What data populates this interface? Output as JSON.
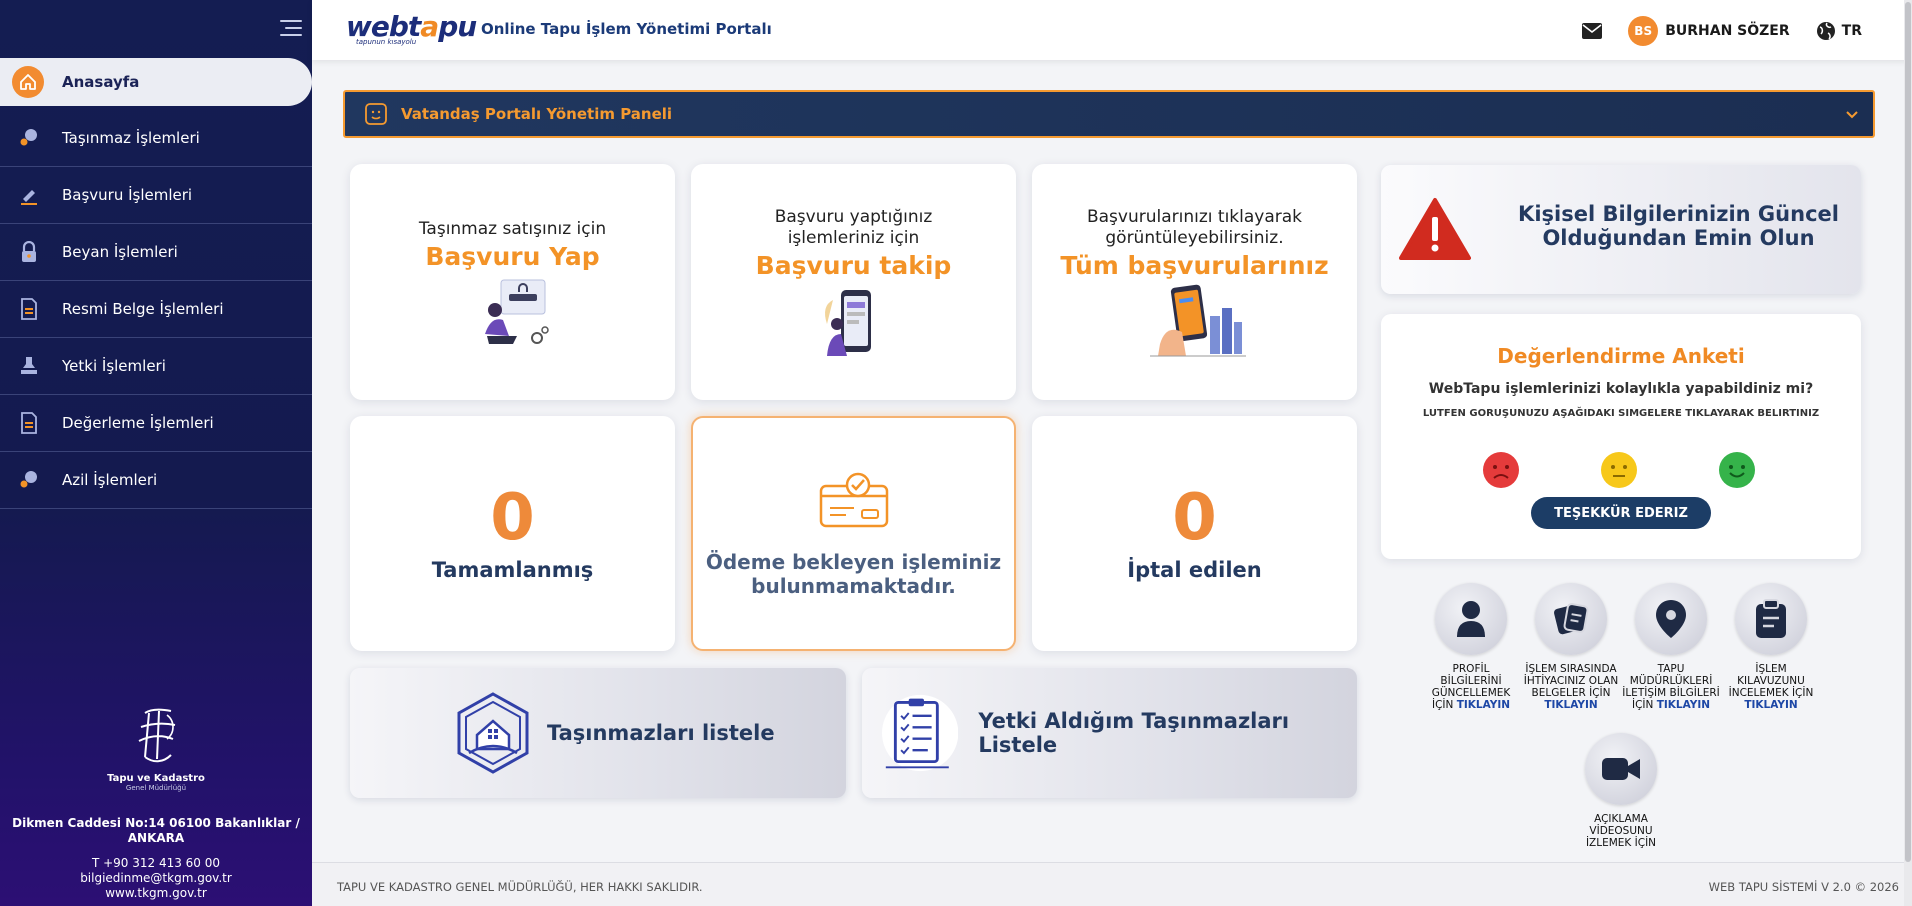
{
  "header": {
    "brand_prefix": "web",
    "brand_mid": "t",
    "brand_o": "a",
    "brand_suffix": "pu",
    "brand_tagline": "tapunun kısayolu",
    "portal_title": "Online Tapu İşlem Yönetimi Portalı",
    "user_initials": "BS",
    "user_name": "BURHAN SÖZER",
    "language": "TR",
    "icons": [
      "menu-icon",
      "mail-icon",
      "globe-icon"
    ]
  },
  "sidebar": {
    "items": [
      {
        "label": "Anasayfa",
        "icon": "home-icon",
        "active": true
      },
      {
        "label": "Taşınmaz İşlemleri",
        "icon": "map-pin-icon"
      },
      {
        "label": "Başvuru İşlemleri",
        "icon": "pen-icon"
      },
      {
        "label": "Beyan İşlemleri",
        "icon": "lock-icon"
      },
      {
        "label": "Resmi Belge İşlemleri",
        "icon": "document-icon"
      },
      {
        "label": "Yetki İşlemleri",
        "icon": "stamp-icon"
      },
      {
        "label": "Değerleme İşlemleri",
        "icon": "document-icon"
      },
      {
        "label": "Azil İşlemleri",
        "icon": "map-pin-icon"
      }
    ],
    "logo_name": "Tapu ve Kadastro",
    "logo_sub": "Genel Müdürlüğü",
    "address": "Dikmen Caddesi No:14 06100 Bakanlıklar / ANKARA",
    "phone": "T +90 312 413 60 00",
    "email": "bilgiedinme@tkgm.gov.tr",
    "website": "www.tkgm.gov.tr"
  },
  "panel": {
    "title": "Vatandaş Portalı Yönetim Paneli"
  },
  "cards": {
    "apply": {
      "small": "Taşınmaz satışınız için",
      "big": "Başvuru Yap"
    },
    "track": {
      "small": "Başvuru yaptığınız işlemleriniz için",
      "big": "Başvuru takip"
    },
    "all": {
      "small": "Başvurularınızı tıklayarak görüntüleyebilirsiniz.",
      "big": "Tüm başvurularınız"
    },
    "completed": {
      "count": "0",
      "label": "Tamamlanmış"
    },
    "payment": {
      "text": "Ödeme bekleyen işleminiz bulunmamaktadır."
    },
    "cancelled": {
      "count": "0",
      "label": "İptal edilen"
    },
    "list_properties": "Taşınmazları listele",
    "list_authorized": "Yetki Aldığım Taşınmazları Listele"
  },
  "warning": {
    "text": "Kişisel Bilgilerinizin Güncel Olduğundan Emin Olun",
    "color": "#d12b1f"
  },
  "survey": {
    "title": "Değerlendirme Anketi",
    "question": "WebTapu işlemlerinizi kolaylıkla yapabildiniz mi?",
    "hint": "LUTFEN GORUŞUNUZU AŞAĞIDAKI SIMGELERE TIKLAYARAK BELIRTINIZ",
    "faces": [
      {
        "name": "sad-face-icon",
        "color": "#e53b3b"
      },
      {
        "name": "neutral-face-icon",
        "color": "#f7c81a"
      },
      {
        "name": "happy-face-icon",
        "color": "#35b34a"
      }
    ],
    "thanks_button": "TEŞEKKÜR EDERIZ"
  },
  "quicklinks": [
    {
      "text": "PROFİL BİLGİLERİNİ GÜNCELLEMEK İÇİN",
      "cta": "TIKLAYIN",
      "icon": "user-icon"
    },
    {
      "text": "İŞLEM SIRASINDA İHTİYACINIZ OLAN BELGELER İÇİN",
      "cta": "TIKLAYIN",
      "icon": "documents-icon"
    },
    {
      "text": "TAPU MÜDÜRLÜKLERİ İLETİŞİM BİLGİLERİ İÇİN",
      "cta": "TIKLAYIN",
      "icon": "location-icon"
    },
    {
      "text": "İŞLEM KILAVUZUNU İNCELEMEK İÇİN",
      "cta": "TIKLAYIN",
      "icon": "clipboard-icon"
    },
    {
      "text": "AÇIKLAMA VİDEOSUNU İZLEMEK İÇİN",
      "cta": "",
      "icon": "video-icon"
    }
  ],
  "footer": {
    "left": "TAPU VE KADASTRO GENEL MÜDÜRLÜĞÜ, HER HAKKI SAKLIDIR.",
    "right": "WEB TAPU SİSTEMİ V 2.0 © 2026"
  },
  "colors": {
    "accent": "#f39327",
    "navy": "#141d52",
    "text_dark": "#243a60"
  }
}
